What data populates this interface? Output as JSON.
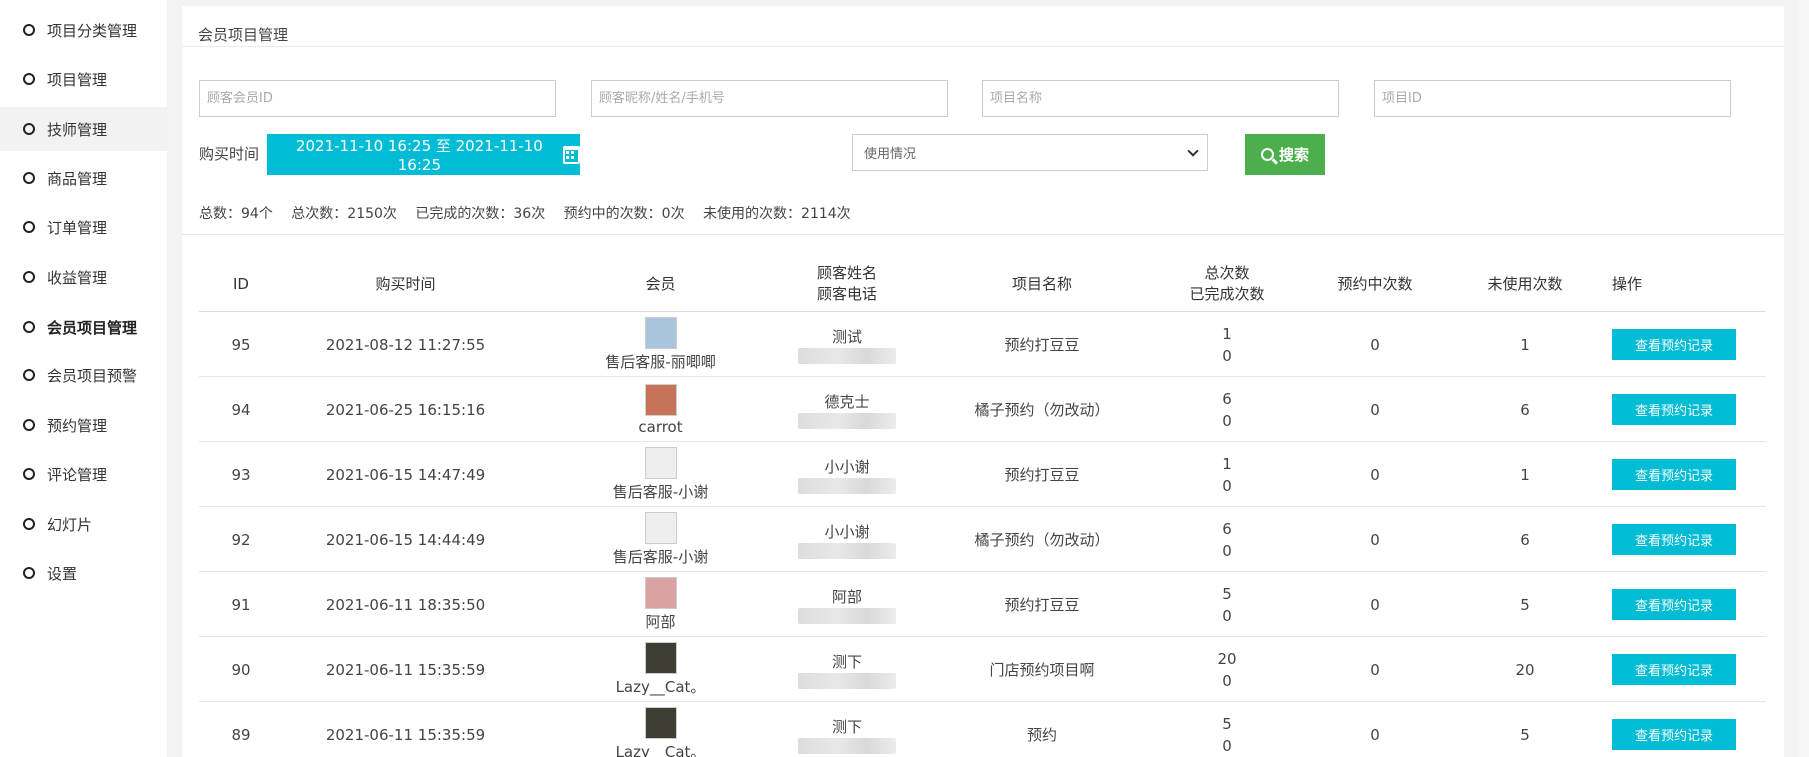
{
  "sidebar": {
    "items": [
      {
        "label": "项目分类管理"
      },
      {
        "label": "项目管理"
      },
      {
        "label": "技师管理"
      },
      {
        "label": "商品管理"
      },
      {
        "label": "订单管理"
      },
      {
        "label": "收益管理"
      },
      {
        "label": "会员项目管理"
      },
      {
        "label": "会员项目预警"
      },
      {
        "label": "预约管理"
      },
      {
        "label": "评论管理"
      },
      {
        "label": "幻灯片"
      },
      {
        "label": "设置"
      }
    ],
    "active": "会员项目管理",
    "hovered": "技师管理"
  },
  "panel": {
    "title": "会员项目管理"
  },
  "filters": {
    "member_id_placeholder": "顾客会员ID",
    "customer_placeholder": "顾客昵称/姓名/手机号",
    "project_name_placeholder": "项目名称",
    "project_id_placeholder": "项目ID",
    "buy_time_label": "购买时间",
    "date_range": "2021-11-10 16:25 至 2021-11-10 16:25",
    "usage_select": "使用情况",
    "search_label": "搜索"
  },
  "stats": {
    "total": "总数：94个",
    "total_times": "总次数：2150次",
    "completed": "已完成的次数：36次",
    "reserving": "预约中的次数：0次",
    "unused": "未使用的次数：2114次"
  },
  "table": {
    "headers": {
      "id": "ID",
      "buy_time": "购买时间",
      "member": "会员",
      "cust_name": "顾客姓名",
      "cust_phone": "顾客电话",
      "project": "项目名称",
      "total": "总次数",
      "done": "已完成次数",
      "reserving": "预约中次数",
      "unused": "未使用次数",
      "action": "操作"
    },
    "action_label": "查看预约记录",
    "rows": [
      {
        "id": "95",
        "time": "2021-08-12 11:27:55",
        "member": "售后客服-丽唧唧",
        "avatar_color": "#a9c4dd",
        "cust_name": "测试",
        "project": "预约打豆豆",
        "total": "1",
        "done": "0",
        "reserving": "0",
        "unused": "1"
      },
      {
        "id": "94",
        "time": "2021-06-25 16:15:16",
        "member": "carrot",
        "avatar_color": "#c7735a",
        "cust_name": "德克士",
        "project": "橘子预约（勿改动）",
        "total": "6",
        "done": "0",
        "reserving": "0",
        "unused": "6"
      },
      {
        "id": "93",
        "time": "2021-06-15 14:47:49",
        "member": "售后客服-小谢",
        "avatar_color": "#eeeeee",
        "cust_name": "小小谢",
        "project": "预约打豆豆",
        "total": "1",
        "done": "0",
        "reserving": "0",
        "unused": "1"
      },
      {
        "id": "92",
        "time": "2021-06-15 14:44:49",
        "member": "售后客服-小谢",
        "avatar_color": "#eeeeee",
        "cust_name": "小小谢",
        "project": "橘子预约（勿改动）",
        "total": "6",
        "done": "0",
        "reserving": "0",
        "unused": "6"
      },
      {
        "id": "91",
        "time": "2021-06-11 18:35:50",
        "member": "阿部",
        "avatar_color": "#d9a3a3",
        "cust_name": "阿部",
        "project": "预约打豆豆",
        "total": "5",
        "done": "0",
        "reserving": "0",
        "unused": "5"
      },
      {
        "id": "90",
        "time": "2021-06-11 15:35:59",
        "member": "Lazy__Cat。",
        "avatar_color": "#3d3d33",
        "cust_name": "测下",
        "project": "门店预约项目啊",
        "total": "20",
        "done": "0",
        "reserving": "0",
        "unused": "20"
      },
      {
        "id": "89",
        "time": "2021-06-11 15:35:59",
        "member": "Lazy__Cat。",
        "avatar_color": "#3d3d33",
        "cust_name": "测下",
        "project": "预约",
        "total": "5",
        "done": "0",
        "reserving": "0",
        "unused": "5"
      }
    ]
  }
}
